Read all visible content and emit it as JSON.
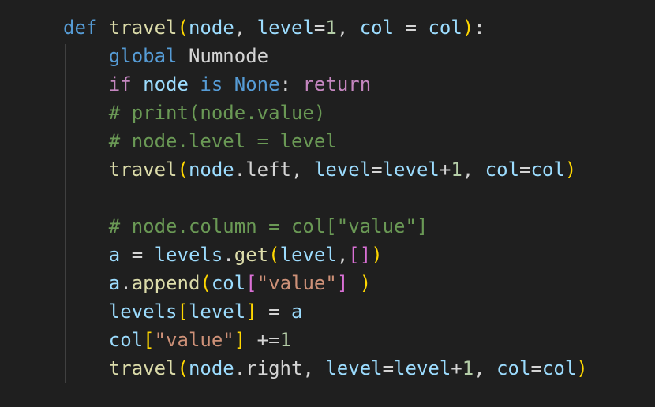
{
  "colors": {
    "background": "#1f1f1f",
    "keyword": "#569cd6",
    "control": "#c586c0",
    "function": "#dcdcaa",
    "variable": "#9cdcfe",
    "number": "#b5cea8",
    "string": "#ce9178",
    "comment": "#6a9955",
    "text": "#d4d4d4",
    "bracket1": "#ffd700",
    "bracket2": "#da70d6",
    "bracket3": "#179fff"
  },
  "code": {
    "lines": [
      [
        {
          "t": "def",
          "c": "kw"
        },
        {
          "t": " ",
          "c": "pl"
        },
        {
          "t": "travel",
          "c": "fn"
        },
        {
          "t": "(",
          "c": "b1"
        },
        {
          "t": "node",
          "c": "var"
        },
        {
          "t": ", ",
          "c": "pl"
        },
        {
          "t": "level",
          "c": "var"
        },
        {
          "t": "=",
          "c": "pl"
        },
        {
          "t": "1",
          "c": "num"
        },
        {
          "t": ", ",
          "c": "pl"
        },
        {
          "t": "col",
          "c": "var"
        },
        {
          "t": " = ",
          "c": "pl"
        },
        {
          "t": "col",
          "c": "var"
        },
        {
          "t": ")",
          "c": "b1"
        },
        {
          "t": ":",
          "c": "pl"
        }
      ],
      [
        {
          "t": "    ",
          "c": "pl"
        },
        {
          "t": "global",
          "c": "kw"
        },
        {
          "t": " Numnode",
          "c": "pl"
        }
      ],
      [
        {
          "t": "    ",
          "c": "pl"
        },
        {
          "t": "if",
          "c": "ctl"
        },
        {
          "t": " ",
          "c": "pl"
        },
        {
          "t": "node",
          "c": "var"
        },
        {
          "t": " ",
          "c": "pl"
        },
        {
          "t": "is",
          "c": "kw"
        },
        {
          "t": " ",
          "c": "pl"
        },
        {
          "t": "None",
          "c": "const"
        },
        {
          "t": ": ",
          "c": "pl"
        },
        {
          "t": "return",
          "c": "ctl"
        }
      ],
      [
        {
          "t": "    ",
          "c": "pl"
        },
        {
          "t": "# print(node.value)",
          "c": "cmt"
        }
      ],
      [
        {
          "t": "    ",
          "c": "pl"
        },
        {
          "t": "# node.level = level",
          "c": "cmt"
        }
      ],
      [
        {
          "t": "    ",
          "c": "pl"
        },
        {
          "t": "travel",
          "c": "fn"
        },
        {
          "t": "(",
          "c": "b1"
        },
        {
          "t": "node",
          "c": "var"
        },
        {
          "t": ".left, ",
          "c": "pl"
        },
        {
          "t": "level",
          "c": "var"
        },
        {
          "t": "=",
          "c": "pl"
        },
        {
          "t": "level",
          "c": "var"
        },
        {
          "t": "+",
          "c": "pl"
        },
        {
          "t": "1",
          "c": "num"
        },
        {
          "t": ", ",
          "c": "pl"
        },
        {
          "t": "col",
          "c": "var"
        },
        {
          "t": "=",
          "c": "pl"
        },
        {
          "t": "col",
          "c": "var"
        },
        {
          "t": ")",
          "c": "b1"
        }
      ],
      [],
      [
        {
          "t": "    ",
          "c": "pl"
        },
        {
          "t": "# node.column = col[\"value\"]",
          "c": "cmt"
        }
      ],
      [
        {
          "t": "    ",
          "c": "pl"
        },
        {
          "t": "a",
          "c": "var"
        },
        {
          "t": " = ",
          "c": "pl"
        },
        {
          "t": "levels",
          "c": "var"
        },
        {
          "t": ".",
          "c": "pl"
        },
        {
          "t": "get",
          "c": "fn"
        },
        {
          "t": "(",
          "c": "b1"
        },
        {
          "t": "level",
          "c": "var"
        },
        {
          "t": ",",
          "c": "pl"
        },
        {
          "t": "[]",
          "c": "b2"
        },
        {
          "t": ")",
          "c": "b1"
        }
      ],
      [
        {
          "t": "    ",
          "c": "pl"
        },
        {
          "t": "a",
          "c": "var"
        },
        {
          "t": ".",
          "c": "pl"
        },
        {
          "t": "append",
          "c": "fn"
        },
        {
          "t": "(",
          "c": "b1"
        },
        {
          "t": "col",
          "c": "var"
        },
        {
          "t": "[",
          "c": "b2"
        },
        {
          "t": "\"value\"",
          "c": "str"
        },
        {
          "t": "]",
          "c": "b2"
        },
        {
          "t": " ",
          "c": "pl"
        },
        {
          "t": ")",
          "c": "b1"
        }
      ],
      [
        {
          "t": "    ",
          "c": "pl"
        },
        {
          "t": "levels",
          "c": "var"
        },
        {
          "t": "[",
          "c": "b1"
        },
        {
          "t": "level",
          "c": "var"
        },
        {
          "t": "]",
          "c": "b1"
        },
        {
          "t": " = ",
          "c": "pl"
        },
        {
          "t": "a",
          "c": "var"
        }
      ],
      [
        {
          "t": "    ",
          "c": "pl"
        },
        {
          "t": "col",
          "c": "var"
        },
        {
          "t": "[",
          "c": "b1"
        },
        {
          "t": "\"value\"",
          "c": "str"
        },
        {
          "t": "]",
          "c": "b1"
        },
        {
          "t": " +=",
          "c": "pl"
        },
        {
          "t": "1",
          "c": "num"
        }
      ],
      [
        {
          "t": "    ",
          "c": "pl"
        },
        {
          "t": "travel",
          "c": "fn"
        },
        {
          "t": "(",
          "c": "b1"
        },
        {
          "t": "node",
          "c": "var"
        },
        {
          "t": ".right, ",
          "c": "pl"
        },
        {
          "t": "level",
          "c": "var"
        },
        {
          "t": "=",
          "c": "pl"
        },
        {
          "t": "level",
          "c": "var"
        },
        {
          "t": "+",
          "c": "pl"
        },
        {
          "t": "1",
          "c": "num"
        },
        {
          "t": ", ",
          "c": "pl"
        },
        {
          "t": "col",
          "c": "var"
        },
        {
          "t": "=",
          "c": "pl"
        },
        {
          "t": "col",
          "c": "var"
        },
        {
          "t": ")",
          "c": "b1"
        }
      ]
    ]
  }
}
